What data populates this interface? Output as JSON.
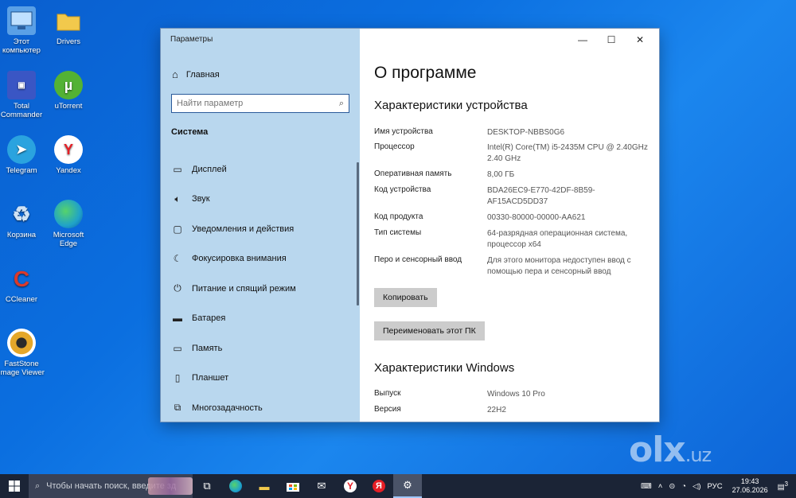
{
  "desktop_icons": [
    {
      "label": "Этот компьютер",
      "icon": "computer-icon",
      "color": "#5aa0e6"
    },
    {
      "label": "Drivers",
      "icon": "folder-icon",
      "color": "#f2c94c"
    },
    {
      "label": "Total Commander",
      "icon": "floppy-icon",
      "color": "#3a56c4"
    },
    {
      "label": "uTorrent",
      "icon": "utorrent-icon",
      "color": "#53b234"
    },
    {
      "label": "Telegram",
      "icon": "telegram-icon",
      "color": "#2aa3df"
    },
    {
      "label": "Yandex",
      "icon": "yandex-browser-icon",
      "color": "#ffffff"
    },
    {
      "label": "Корзина",
      "icon": "recycle-bin-icon",
      "color": "#cfe2f5"
    },
    {
      "label": "Microsoft Edge",
      "icon": "edge-icon",
      "color": "#1fa2c9"
    },
    {
      "label": "CCleaner",
      "icon": "ccleaner-icon",
      "color": "#d93a2b"
    },
    {
      "label": "FastStone Image Viewer",
      "icon": "faststone-icon",
      "color": "#e4a72a"
    }
  ],
  "window": {
    "app_title": "Параметры",
    "home_label": "Главная",
    "search_placeholder": "Найти параметр",
    "section_label": "Система",
    "nav_items": [
      {
        "label": "Дисплей",
        "icon": "display-icon"
      },
      {
        "label": "Звук",
        "icon": "sound-icon"
      },
      {
        "label": "Уведомления и действия",
        "icon": "notifications-icon"
      },
      {
        "label": "Фокусировка внимания",
        "icon": "focus-assist-icon"
      },
      {
        "label": "Питание и спящий режим",
        "icon": "power-icon"
      },
      {
        "label": "Батарея",
        "icon": "battery-icon"
      },
      {
        "label": "Память",
        "icon": "storage-icon"
      },
      {
        "label": "Планшет",
        "icon": "tablet-icon"
      },
      {
        "label": "Многозадачность",
        "icon": "multitasking-icon"
      }
    ],
    "page_title": "О программе",
    "device_heading": "Характеристики устройства",
    "device_specs": [
      {
        "label": "Имя устройства",
        "value": "DESKTOP-NBBS0G6"
      },
      {
        "label": "Процессор",
        "value": "Intel(R) Core(TM) i5-2435M CPU @ 2.40GHz   2.40 GHz"
      },
      {
        "label": "Оперативная память",
        "value": "8,00 ГБ"
      },
      {
        "label": "Код устройства",
        "value": "BDA26EC9-E770-42DF-8B59-AF15ACD5DD37"
      },
      {
        "label": "Код продукта",
        "value": "00330-80000-00000-AA621"
      },
      {
        "label": "Тип системы",
        "value": "64-разрядная операционная система, процессор x64"
      },
      {
        "label": "Перо и сенсорный ввод",
        "value": "Для этого монитора недоступен ввод с помощью пера и сенсорный ввод"
      }
    ],
    "copy_button": "Копировать",
    "rename_button": "Переименовать этот ПК",
    "windows_heading": "Характеристики Windows",
    "windows_specs": [
      {
        "label": "Выпуск",
        "value": "Windows 10 Pro"
      },
      {
        "label": "Версия",
        "value": "22H2"
      }
    ]
  },
  "taskbar": {
    "search_text": "Чтобы начать поиск, введите зд",
    "language": "РУС",
    "time": "19:43",
    "date": "27.06.2026",
    "notification_count": "3"
  },
  "watermark": "olx.uz"
}
